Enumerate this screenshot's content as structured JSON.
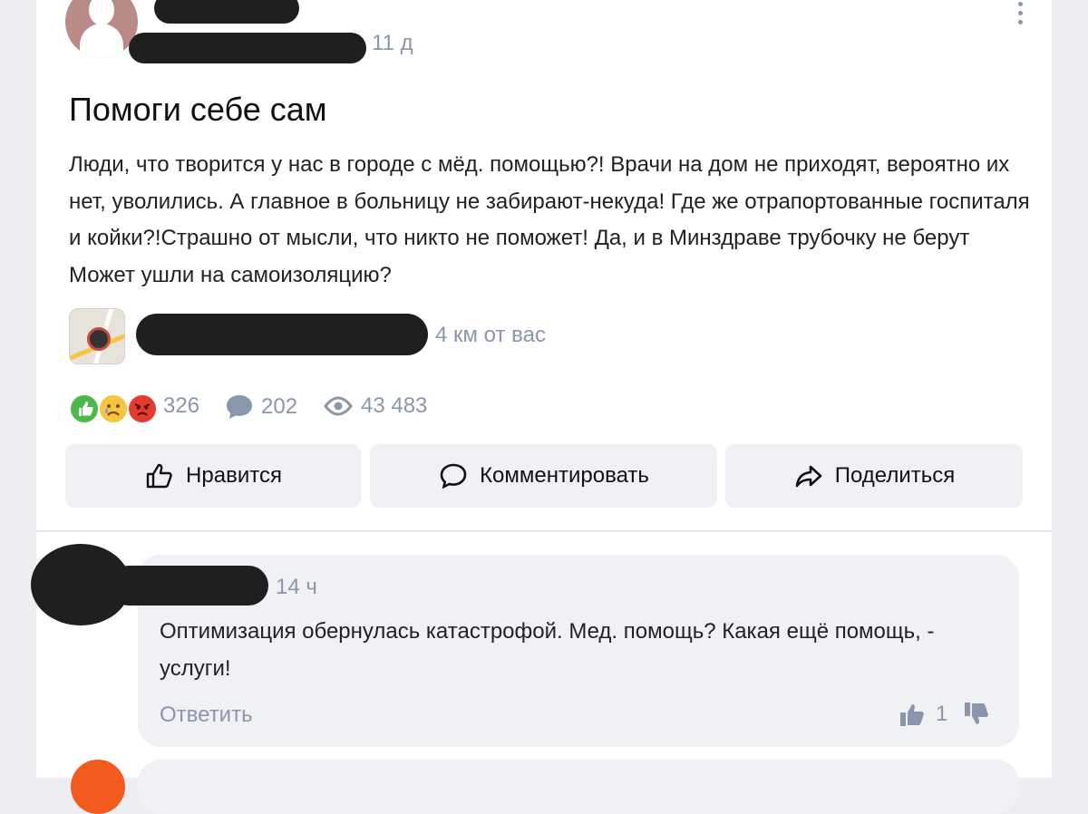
{
  "post": {
    "time": "11 д",
    "title": "Помоги себе сам",
    "body": "Люди, что творится у нас в городе с мёд. помощью?! Врачи на дом не приходят, вероятно их нет, уволились. А главное в больницу не забирают-некуда! Где же отрапортованные госпиталя и койки?!Страшно от мысли, что никто не поможет! Да, и в Минздраве трубочку не берут Может ушли на самоизоляцию?",
    "distance": "4 км от вас",
    "stats": {
      "reactions_count": "326",
      "comments_count": "202",
      "views_count": "43 483"
    },
    "reaction_icons": [
      "thumbs-up-emoji-icon",
      "sad-emoji-icon",
      "angry-emoji-icon"
    ]
  },
  "actions": {
    "like_label": "Нравится",
    "comment_label": "Комментировать",
    "share_label": "Поделиться"
  },
  "comment": {
    "time": "14 ч",
    "text": "Оптимизация обернулась катастрофой. Мед. помощь? Какая ещё помощь, - услуги!",
    "reply_label": "Ответить",
    "likes": "1"
  },
  "colors": {
    "background": "#eceef2",
    "card": "#ffffff",
    "muted_text": "#8a97ab",
    "button_bg": "#eff1f4",
    "like_green": "#4cb84a",
    "angry_red": "#e53b2c",
    "sad_yellow": "#f5c542"
  }
}
